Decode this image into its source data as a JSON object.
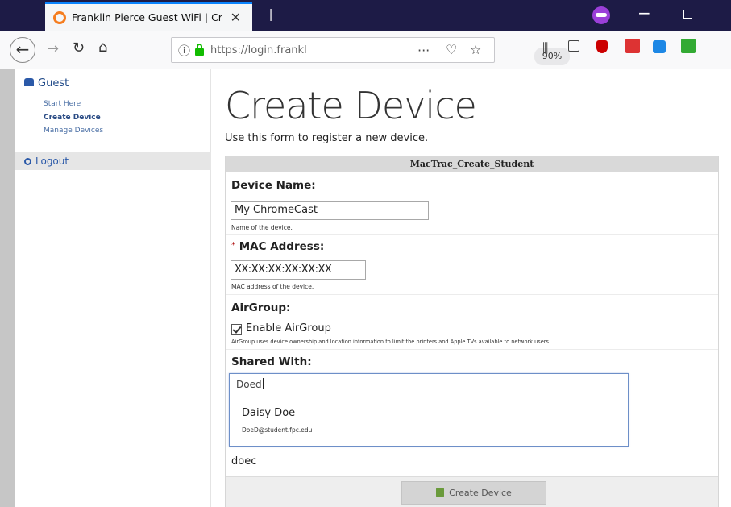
{
  "browser": {
    "tab_title": "Franklin Pierce Guest WiFi | Cr",
    "url": "https://login.frankli",
    "zoom": "90%",
    "more": "···",
    "icons": [
      "back-icon",
      "forward-icon",
      "reload-icon",
      "home-icon",
      "site-info-icon",
      "lock-icon",
      "pocket-icon",
      "bookmark-star-icon",
      "library-icon",
      "sidebar-icon",
      "ublock-icon",
      "extension-icons"
    ]
  },
  "sidebar": {
    "section": "Guest",
    "items": [
      {
        "label": "Start Here"
      },
      {
        "label": "Create Device"
      },
      {
        "label": "Manage Devices"
      }
    ],
    "logout": "Logout"
  },
  "main": {
    "title": "Create Device",
    "subtitle": "Use this form to register a new device.",
    "form_title": "MacTrac_Create_Student",
    "device_name": {
      "label": "Device Name:",
      "value": "My ChromeCast",
      "hint": "Name of the device."
    },
    "mac": {
      "required": "*",
      "label": "MAC Address:",
      "value": "XX:XX:XX:XX:XX:XX",
      "hint": "MAC address of the device."
    },
    "airgroup": {
      "label": "AirGroup:",
      "checkbox_label": "Enable AirGroup",
      "checked": true,
      "hint": "AirGroup uses device ownership and location information to limit the printers and Apple TVs available to network users."
    },
    "shared": {
      "label": "Shared With:",
      "input_value": "Doed",
      "suggestion_name": "Daisy Doe",
      "suggestion_email": "DoeD@student.fpc.edu",
      "typed": "doec"
    },
    "submit": "Create Device"
  },
  "colors": {
    "tabbar": "#1d1b46",
    "accent": "#0a84ff",
    "link": "#2b59a8"
  }
}
